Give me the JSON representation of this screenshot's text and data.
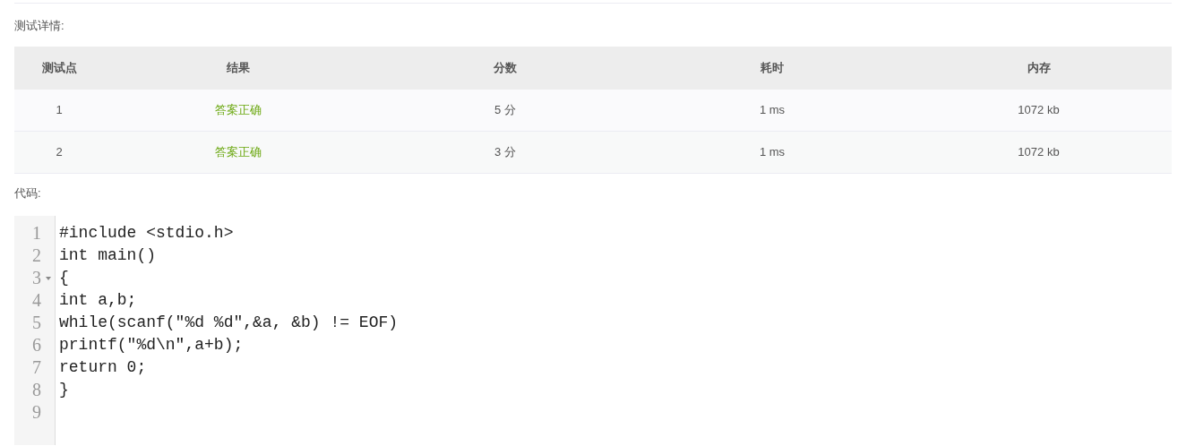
{
  "details_label": "测试详情:",
  "table": {
    "columns": [
      "测试点",
      "结果",
      "分数",
      "耗时",
      "内存"
    ],
    "rows": [
      {
        "case": "1",
        "result": "答案正确",
        "score": "5 分",
        "time": "1 ms",
        "memory": "1072 kb"
      },
      {
        "case": "2",
        "result": "答案正确",
        "score": "3 分",
        "time": "1 ms",
        "memory": "1072 kb"
      }
    ]
  },
  "code_label": "代码:",
  "code": {
    "lines": [
      {
        "number": "1",
        "text": "#include <stdio.h>",
        "foldable": false
      },
      {
        "number": "2",
        "text": "int main()",
        "foldable": false
      },
      {
        "number": "3",
        "text": "{",
        "foldable": true
      },
      {
        "number": "4",
        "text": "int a,b;",
        "foldable": false
      },
      {
        "number": "5",
        "text": "while(scanf(\"%d %d\",&a, &b) != EOF)",
        "foldable": false
      },
      {
        "number": "6",
        "text": "printf(\"%d\\n\",a+b);",
        "foldable": false
      },
      {
        "number": "7",
        "text": "return 0;",
        "foldable": false
      },
      {
        "number": "8",
        "text": "}",
        "foldable": false
      },
      {
        "number": "9",
        "foldable": false
      }
    ]
  }
}
